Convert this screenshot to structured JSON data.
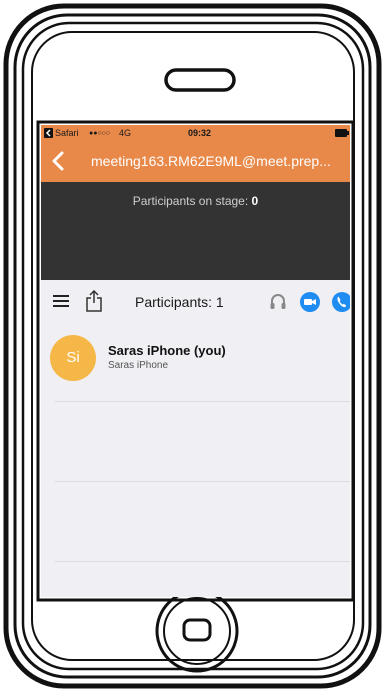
{
  "status_bar": {
    "back_app": "Safari",
    "signal_dots": "●●○○○",
    "network": "4G",
    "time": "09:32"
  },
  "nav": {
    "title": "meeting163.RM62E9ML@meet.prep..."
  },
  "stage": {
    "label": "Participants on stage:",
    "count": "0"
  },
  "toolbar": {
    "title": "Participants: 1",
    "icons": [
      "menu-icon",
      "share-icon",
      "headphones-icon",
      "video-icon",
      "phone-icon"
    ],
    "accent_color": "#1e8cf0"
  },
  "participants": [
    {
      "initials": "Si",
      "name": "Saras iPhone (you)",
      "device": "Saras iPhone",
      "avatar_color": "#f5b747"
    }
  ],
  "colors": {
    "header": "#e8894a",
    "stage": "#333333",
    "background": "#efeff4"
  }
}
